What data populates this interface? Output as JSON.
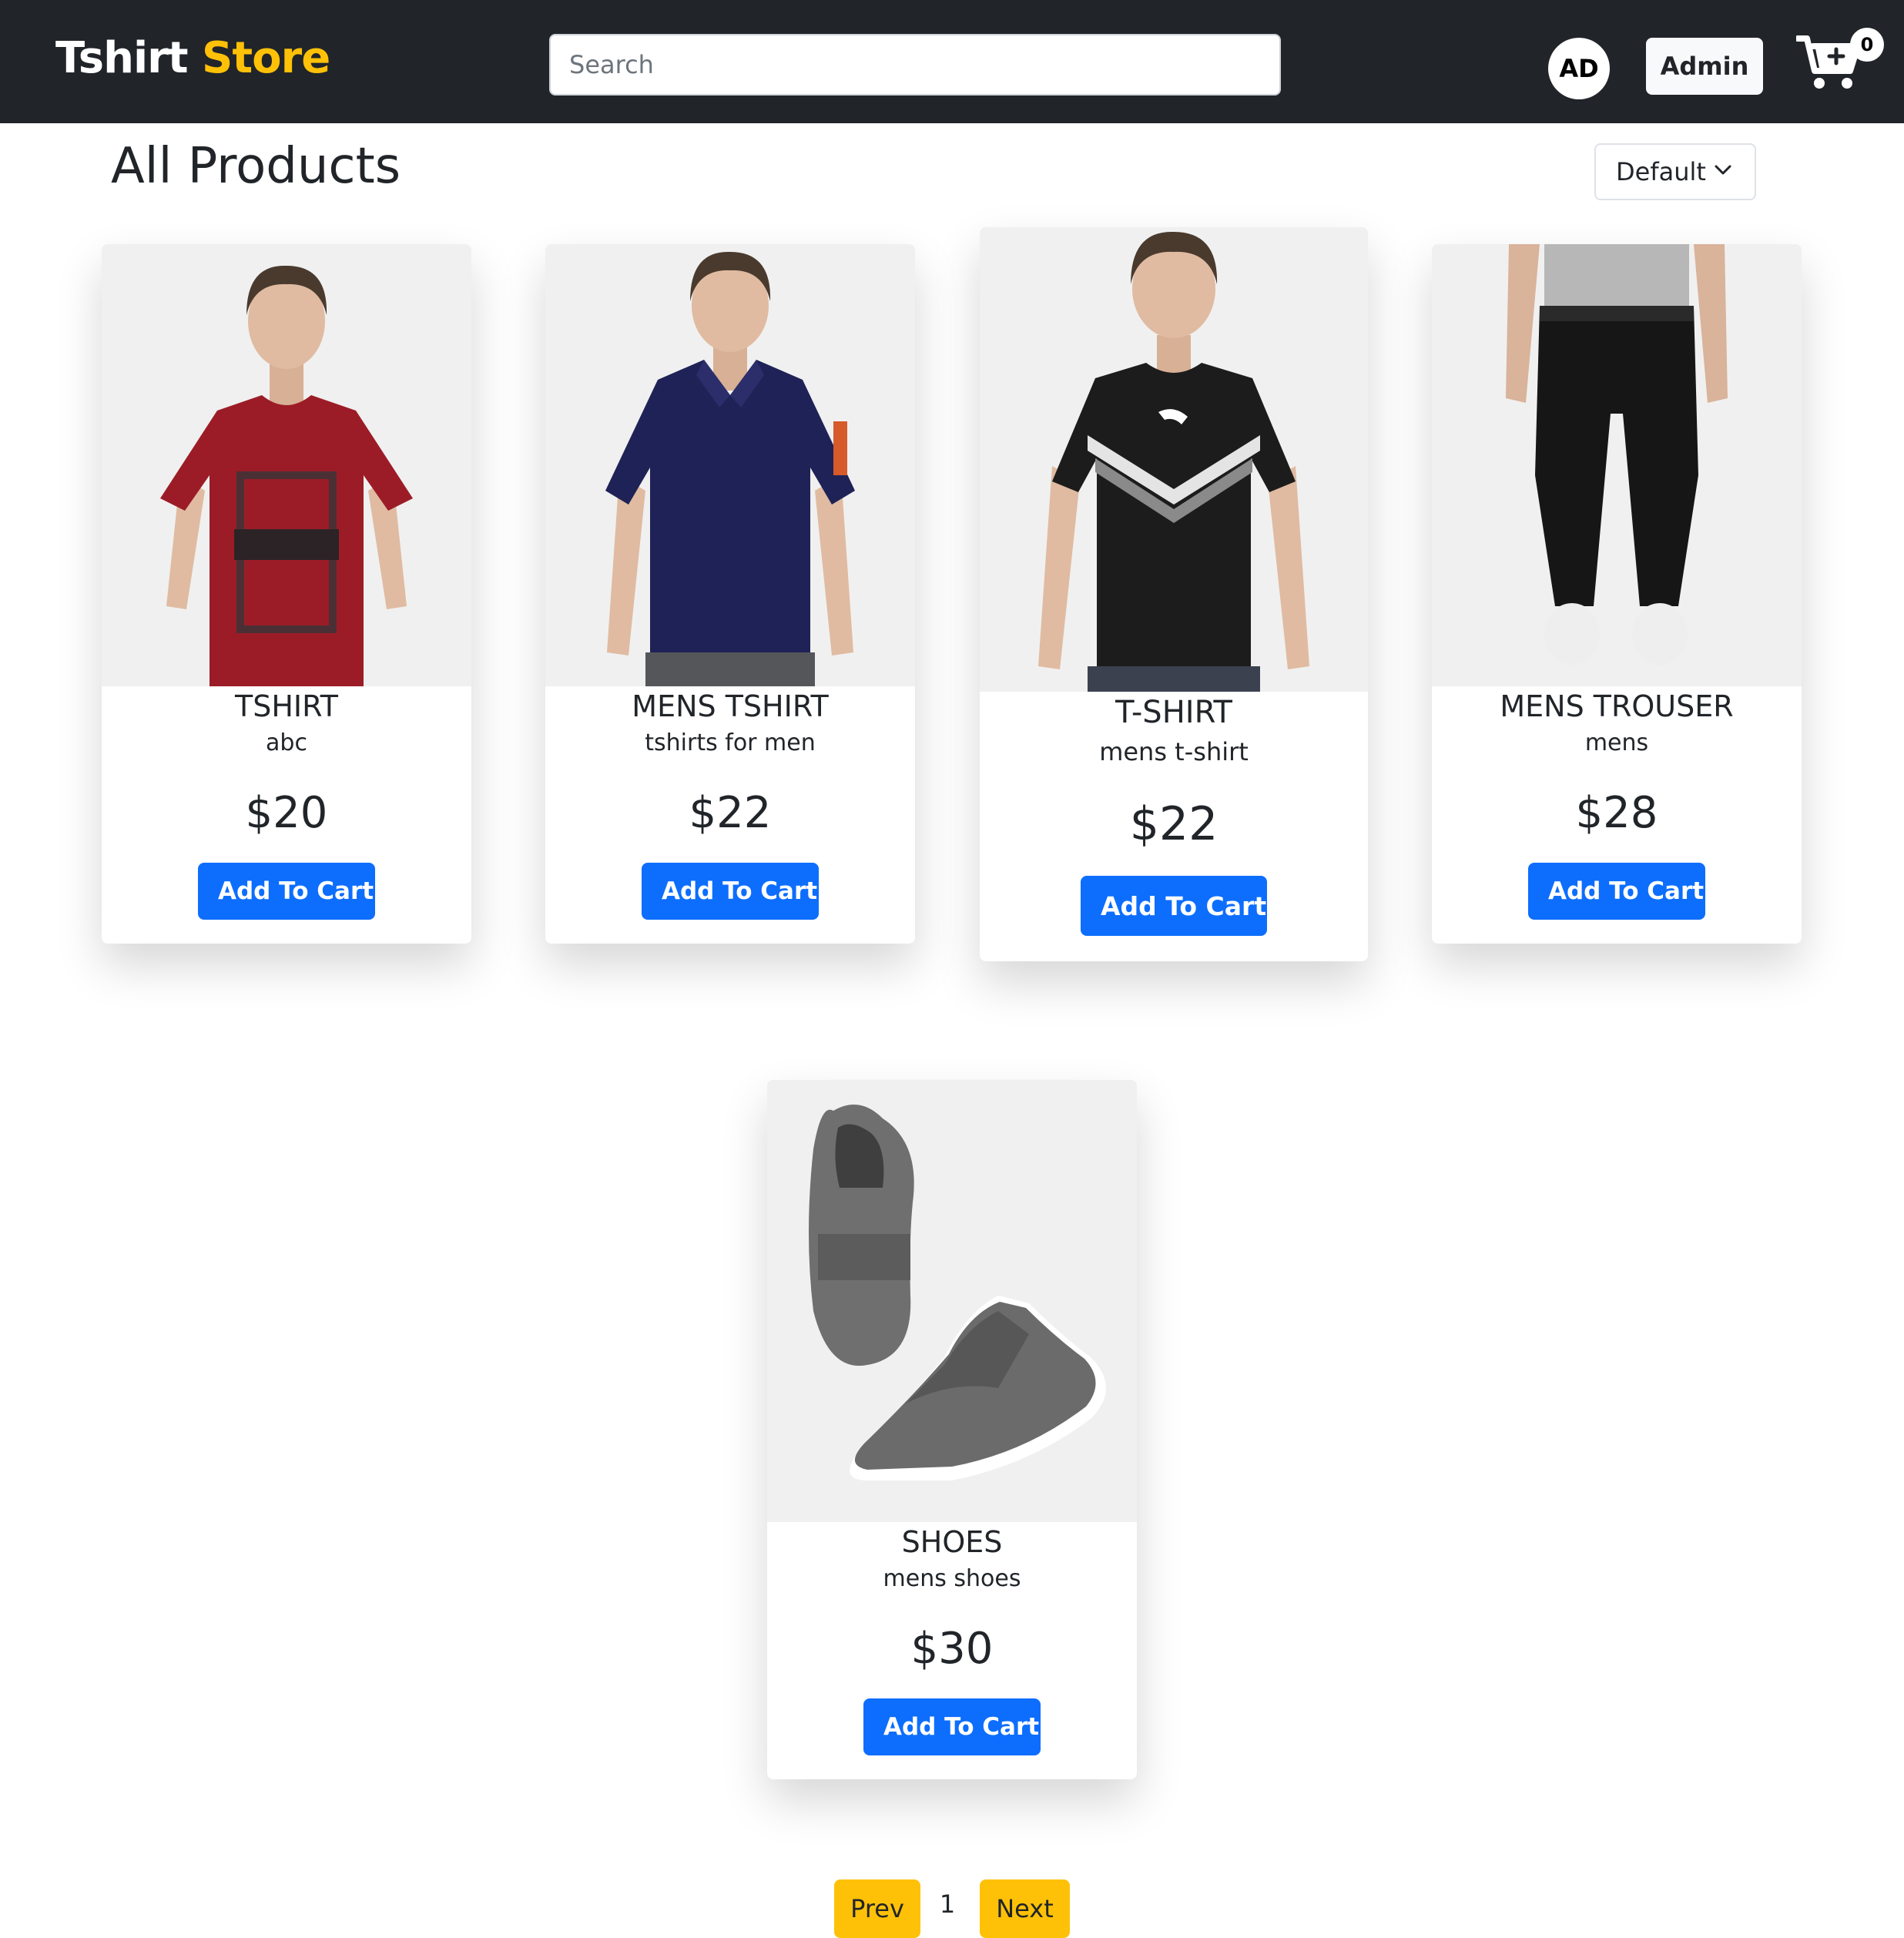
{
  "header": {
    "brand_part1": "Tshirt",
    "brand_part2": "Store",
    "search_placeholder": "Search",
    "avatar_initials": "AD",
    "admin_label": "Admin",
    "cart_count": "0"
  },
  "page": {
    "title": "All Products",
    "sort_value": "Default"
  },
  "products": [
    {
      "name": "TSHIRT",
      "description": "abc",
      "price": "$20",
      "button_label": "Add To Cart"
    },
    {
      "name": "MENS TSHIRT",
      "description": "tshirts for men",
      "price": "$22",
      "button_label": "Add To Cart"
    },
    {
      "name": "T-SHIRT",
      "description": "mens t-shirt",
      "price": "$22",
      "button_label": "Add To Cart"
    },
    {
      "name": "MENS TROUSER",
      "description": "mens",
      "price": "$28",
      "button_label": "Add To Cart"
    },
    {
      "name": "SHOES",
      "description": "mens shoes",
      "price": "$30",
      "button_label": "Add To Cart"
    }
  ],
  "pagination": {
    "prev_label": "Prev",
    "current_page": "1",
    "next_label": "Next"
  },
  "colors": {
    "navbar": "#212529",
    "brand_accent": "#ffc107",
    "primary_button": "#0d6efd",
    "pagination_button": "#ffc107"
  }
}
